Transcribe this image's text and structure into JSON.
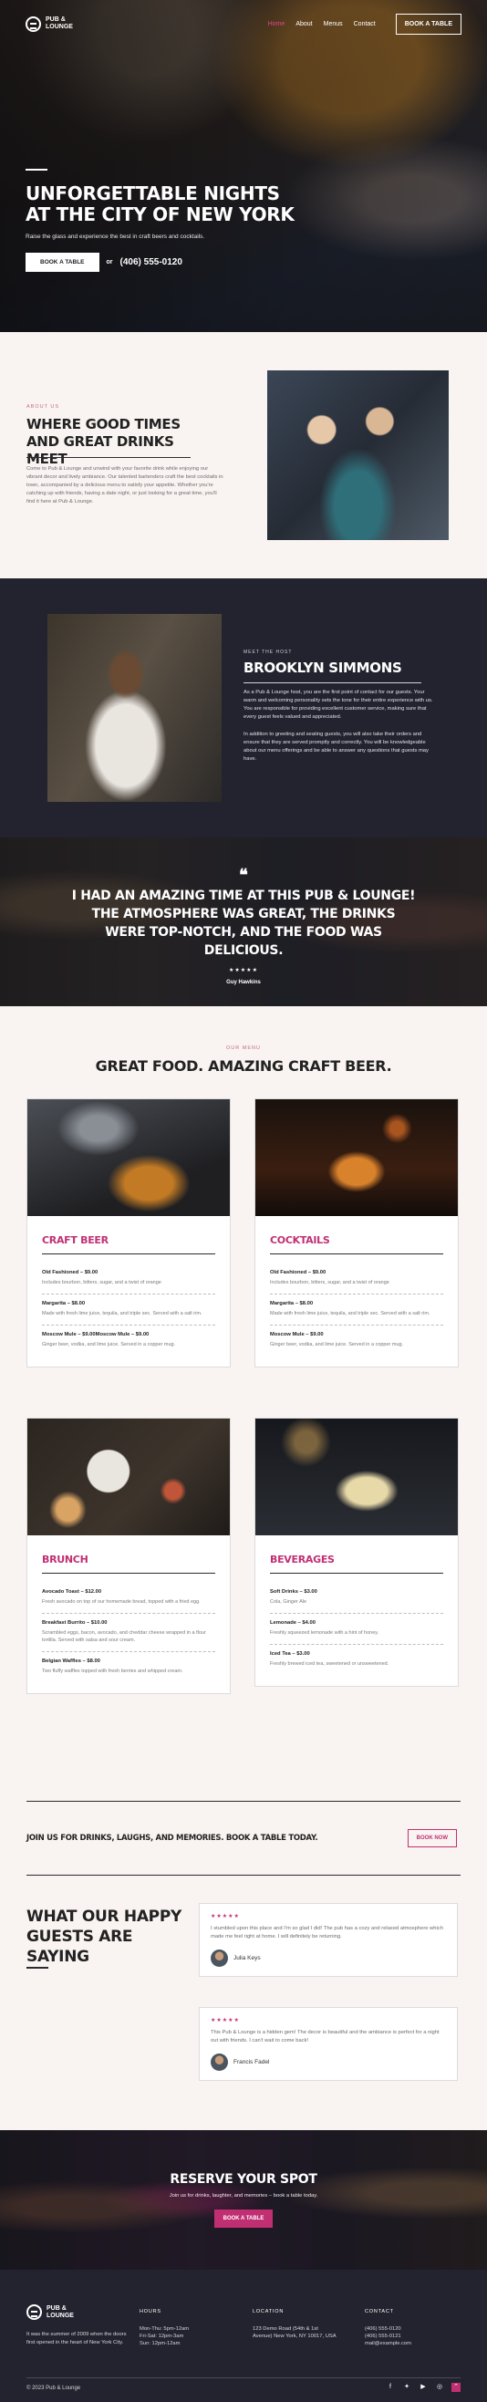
{
  "brand": {
    "name": "Pub & Lounge"
  },
  "nav": {
    "items": [
      "Home",
      "About",
      "Menus",
      "Contact"
    ],
    "active": "Home",
    "cta": "Book a Table"
  },
  "hero": {
    "title": "Unforgettable Nights at the City of New York",
    "subtitle": "Raise the glass and experience the best in craft beers and cocktails.",
    "button": "Book a Table",
    "or": "or",
    "phone": "(406) 555-0120"
  },
  "about": {
    "eyebrow": "About us",
    "title": "Where Good Times and Great Drinks Meet",
    "body": "Come to Pub & Lounge and unwind with your favorite drink while enjoying our vibrant decor and lively ambiance. Our talented bartenders craft the best cocktails in town, accompanied by a delicious menu to satisfy your appetite. Whether you're catching up with friends, having a date night, or just looking for a great time, you'll find it here at Pub & Lounge."
  },
  "host": {
    "eyebrow": "Meet the host",
    "name": "Brooklyn Simmons",
    "p1": "As a Pub & Lounge host, you are the first point of contact for our guests. Your warm and welcoming personality sets the tone for their entire experience with us. You are responsible for providing excellent customer service, making sure that every guest feels valued and appreciated.",
    "p2": "In addition to greeting and seating guests, you will also take their orders and ensure that they are served promptly and correctly. You will be knowledgeable about our menu offerings and be able to answer any questions that guests may have."
  },
  "banner_quote": {
    "mark": "❝",
    "text": "I had an amazing time at this Pub & Lounge! The atmosphere was great, the drinks were top-notch, and the food was delicious.",
    "stars": "★★★★★",
    "author": "Guy Hawkins"
  },
  "menu": {
    "eyebrow": "Our menu",
    "title": "Great Food. Amazing Craft Beer.",
    "cards": [
      {
        "title": "Craft Beer",
        "items": [
          {
            "name": "Old Fashioned – $9.00",
            "desc": "Includes bourbon, bitters, sugar, and a twist of orange"
          },
          {
            "name": "Margarita – $8.00",
            "desc": "Made with fresh lime juice, tequila, and triple sec. Served with a salt rim."
          },
          {
            "name": "Moscow Mule – $9.00Moscow Mule – $9.00",
            "desc": "Ginger beer, vodka, and lime juice. Served in a copper mug."
          }
        ]
      },
      {
        "title": "Cocktails",
        "items": [
          {
            "name": "Old Fashioned – $9.00",
            "desc": "Includes bourbon, bitters, sugar, and a twist of orange"
          },
          {
            "name": "Margarita – $8.00",
            "desc": "Made with fresh lime juice, tequila, and triple sec. Served with a salt rim."
          },
          {
            "name": "Moscow Mule – $9.00",
            "desc": "Ginger beer, vodka, and lime juice. Served in a copper mug."
          }
        ]
      },
      {
        "title": "Brunch",
        "items": [
          {
            "name": "Avocado Toast – $12.00",
            "desc": "Fresh avocado on top of our homemade bread, topped with a fried egg."
          },
          {
            "name": "Breakfast Burrito – $10.00",
            "desc": "Scrambled eggs, bacon, avocado, and cheddar cheese wrapped in a flour tortilla. Served with salsa and sour cream."
          },
          {
            "name": "Belgian Waffles – $8.00",
            "desc": "Two fluffy waffles topped with fresh berries and whipped cream."
          }
        ]
      },
      {
        "title": "Beverages",
        "items": [
          {
            "name": "Soft Drinks – $3.00",
            "desc": "Cola, Ginger Ale"
          },
          {
            "name": "Lemonade – $4.00",
            "desc": "Freshly squeezed lemonade with a hint of honey."
          },
          {
            "name": "Iced Tea – $3.00",
            "desc": "Freshly brewed iced tea, sweetened or unsweetened."
          }
        ]
      }
    ]
  },
  "cta_strip": {
    "text": "Join us for drinks, laughs, and memories. Book a table today.",
    "button": "Book Now"
  },
  "reviews": {
    "title": "What Our Happy Guests Are Saying",
    "items": [
      {
        "stars": "★★★★★",
        "text": "I stumbled upon this place and I'm so glad I did! The pub has a cozy and relaxed atmosphere which made me feel right at home. I will definitely be returning.",
        "name": "Julia Keys"
      },
      {
        "stars": "★★★★★",
        "text": "This Pub & Lounge is a hidden gem! The decor is beautiful and the ambiance is perfect for a night out with friends. I can't wait to come back!",
        "name": "Francis Fadel"
      }
    ]
  },
  "reserve": {
    "title": "Reserve Your Spot",
    "text": "Join us for drinks, laughter, and memories – book a table today.",
    "button": "Book a Table"
  },
  "footer": {
    "about": "It was the summer of 2009 when the doors first opened in the heart of New York City.",
    "hours": {
      "heading": "Hours",
      "lines": [
        "Mon-Thu: 5pm-12am",
        "Fri-Sat: 12pm-3am",
        "Sun: 12pm-12am"
      ]
    },
    "location": {
      "heading": "Location",
      "lines": [
        "123 Demo Road (54th & 1st",
        "Avenue) New York, NY 10017, USA"
      ]
    },
    "contact": {
      "heading": "Contact",
      "lines": [
        "(406) 555-0120",
        "(406) 555-0121",
        "mail@example.com"
      ]
    },
    "copyright": "© 2023 Pub & Lounge",
    "socials": [
      "facebook-icon",
      "twitter-icon",
      "youtube-icon",
      "instagram-icon",
      "scroll-top-icon"
    ]
  }
}
